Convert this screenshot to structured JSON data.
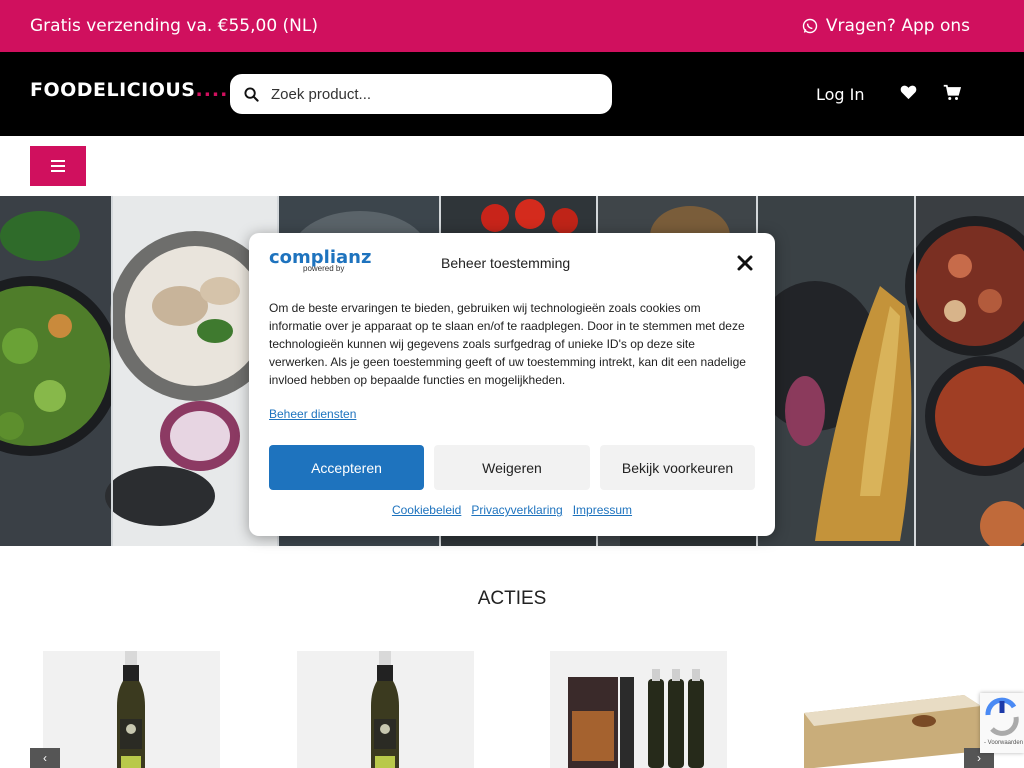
{
  "topbar": {
    "shipping_text": "Gratis verzending va. €55,00 (NL)",
    "whatsapp_text": "Vragen? App ons",
    "background": "#d0105e"
  },
  "header": {
    "logo_text": "FOODELICIOUS",
    "logo_dots": "......",
    "search_placeholder": "Zoek product...",
    "login_label": "Log In",
    "icons": [
      "search-icon",
      "heart-icon",
      "cart-icon"
    ]
  },
  "nav": {
    "menu_icon": "hamburger-icon"
  },
  "consent": {
    "brand": "complianz",
    "brand_sub": "powered by",
    "title": "Beheer toestemming",
    "body": "Om de beste ervaringen te bieden, gebruiken wij technologieën zoals cookies om informatie over je apparaat op te slaan en/of te raadplegen. Door in te stemmen met deze technologieën kunnen wij gegevens zoals surfgedrag of unieke ID's op deze site verwerken. Als je geen toestemming geeft of uw toestemming intrekt, kan dit een nadelige invloed hebben op bepaalde functies en mogelijkheden.",
    "manage_services": "Beheer diensten",
    "accept_label": "Accepteren",
    "deny_label": "Weigeren",
    "prefs_label": "Bekijk voorkeuren",
    "links": [
      "Cookiebeleid",
      "Privacyverklaring",
      "Impressum"
    ],
    "accent": "#1e73be"
  },
  "section": {
    "title": "ACTIES"
  },
  "carousel": {
    "prev_label": "‹",
    "next_label": "›"
  },
  "recaptcha": {
    "text": "- Voorwaarden"
  }
}
